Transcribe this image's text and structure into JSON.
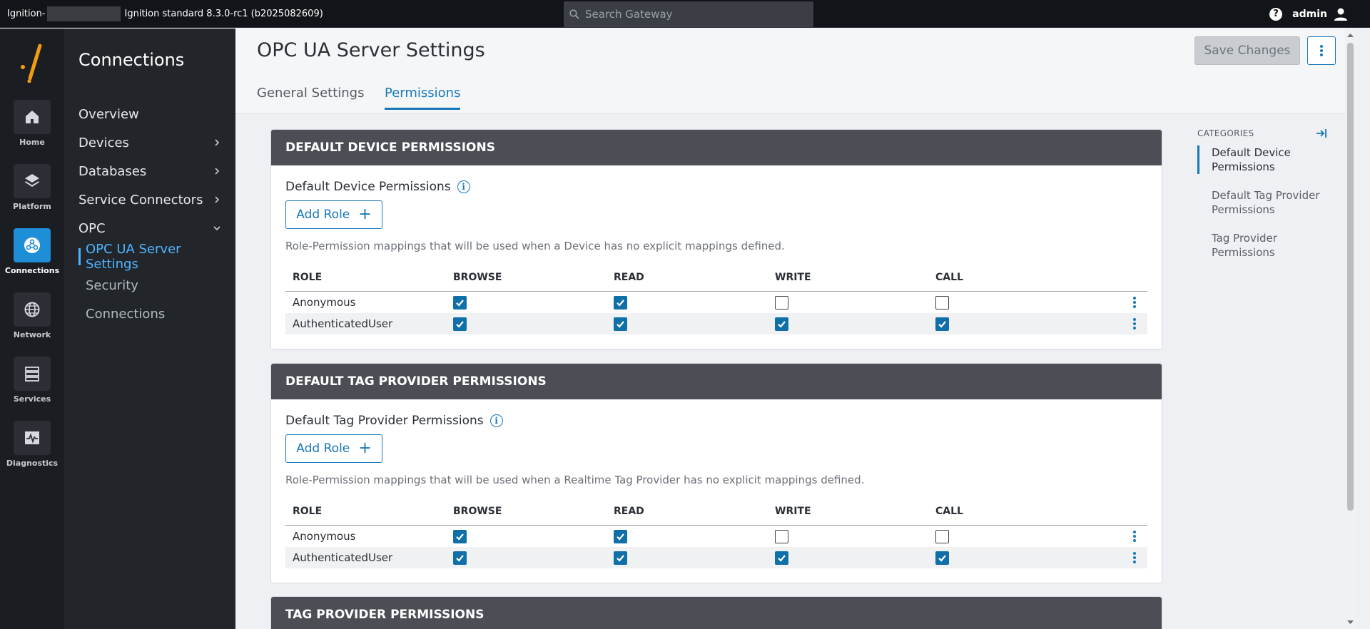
{
  "topbar": {
    "gateway_prefix": "Ignition-",
    "gateway_title": "Ignition standard 8.3.0-rc1 (b2025082609)",
    "search_placeholder": "Search Gateway",
    "user": "admin"
  },
  "rail": {
    "items": [
      {
        "label": "Home",
        "icon": "home-icon"
      },
      {
        "label": "Platform",
        "icon": "layers-icon"
      },
      {
        "label": "Connections",
        "icon": "connections-icon"
      },
      {
        "label": "Network",
        "icon": "globe-icon"
      },
      {
        "label": "Services",
        "icon": "server-icon"
      },
      {
        "label": "Diagnostics",
        "icon": "pulse-icon"
      }
    ],
    "active": "Connections"
  },
  "nav": {
    "title": "Connections",
    "items": [
      {
        "label": "Overview"
      },
      {
        "label": "Devices"
      },
      {
        "label": "Databases"
      },
      {
        "label": "Service Connectors"
      },
      {
        "label": "OPC"
      },
      {
        "label": "OPC UA Server Settings"
      },
      {
        "label": "Security"
      },
      {
        "label": "Connections"
      }
    ]
  },
  "header": {
    "title": "OPC UA Server Settings",
    "tabs": [
      {
        "label": "General Settings"
      },
      {
        "label": "Permissions"
      }
    ],
    "active_tab": "Permissions",
    "save_label": "Save Changes"
  },
  "columns": [
    "ROLE",
    "BROWSE",
    "READ",
    "WRITE",
    "CALL"
  ],
  "sections": [
    {
      "heading": "DEFAULT DEVICE PERMISSIONS",
      "field_label": "Default Device Permissions",
      "add_role": "Add Role",
      "description": "Role-Permission mappings that will be used when a Device has no explicit mappings defined.",
      "rows": [
        {
          "role": "Anonymous",
          "browse": true,
          "read": true,
          "write": false,
          "call": false
        },
        {
          "role": "AuthenticatedUser",
          "browse": true,
          "read": true,
          "write": true,
          "call": true
        }
      ]
    },
    {
      "heading": "DEFAULT TAG PROVIDER PERMISSIONS",
      "field_label": "Default Tag Provider Permissions",
      "add_role": "Add Role",
      "description": "Role-Permission mappings that will be used when a Realtime Tag Provider has no explicit mappings defined.",
      "rows": [
        {
          "role": "Anonymous",
          "browse": true,
          "read": true,
          "write": false,
          "call": false
        },
        {
          "role": "AuthenticatedUser",
          "browse": true,
          "read": true,
          "write": true,
          "call": true
        }
      ]
    },
    {
      "heading": "TAG PROVIDER PERMISSIONS"
    }
  ],
  "categories": {
    "title": "CATEGORIES",
    "items": [
      {
        "label": "Default Device Permissions"
      },
      {
        "label": "Default Tag Provider Permissions"
      },
      {
        "label": "Tag Provider Permissions"
      }
    ]
  },
  "colors": {
    "accent": "#1778b8",
    "active_rail": "#1e8ed6",
    "checkbox_on": "#0f6fa9",
    "card_header": "#4b4f55"
  }
}
